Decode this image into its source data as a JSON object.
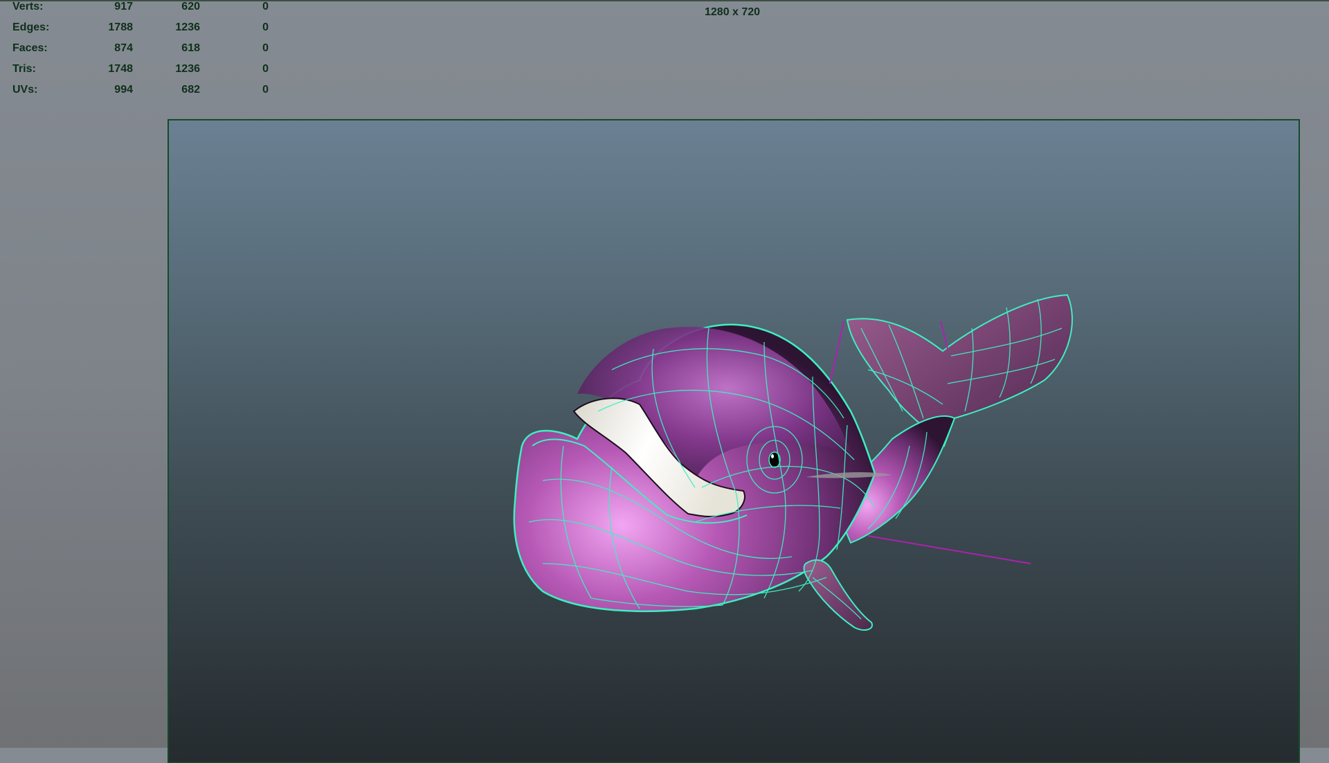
{
  "hud": {
    "stats": [
      {
        "label": "Verts:",
        "values": [
          "917",
          "620",
          "0"
        ]
      },
      {
        "label": "Edges:",
        "values": [
          "1788",
          "1236",
          "0"
        ]
      },
      {
        "label": "Faces:",
        "values": [
          "874",
          "618",
          "0"
        ]
      },
      {
        "label": "Tris:",
        "values": [
          "1748",
          "1236",
          "0"
        ]
      },
      {
        "label": "UVs:",
        "values": [
          "994",
          "682",
          "0"
        ]
      }
    ]
  },
  "viewport": {
    "resolution_label": "1280 x 720"
  },
  "colors": {
    "hud_text": "#0e2f1a",
    "wireframe": "#3df0c0",
    "whale_body": "#8a3f8f",
    "joint_lines": "#b020b0"
  }
}
